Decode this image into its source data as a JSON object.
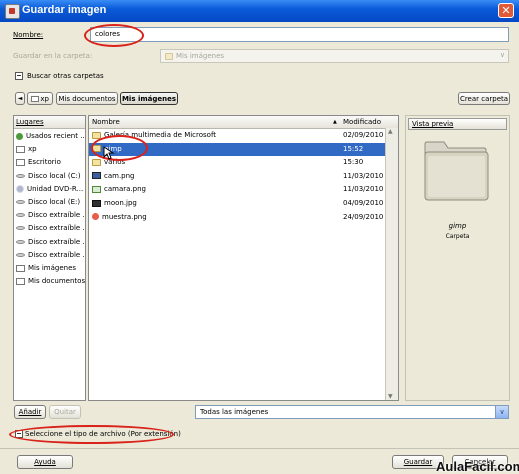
{
  "window": {
    "title": "Guardar imagen",
    "close_glyph": "✕"
  },
  "form": {
    "name_label": "Nombre:",
    "name_value": "colores",
    "folder_label": "Guardar en la carpeta:",
    "folder_value": "Mis imágenes",
    "browse_toggle": "Buscar otras carpetas"
  },
  "pathbar": {
    "back_glyph": "◄",
    "crumbs": [
      "xp",
      "Mis documentos",
      "Mis imágenes"
    ],
    "create_folder": "Crear carpeta"
  },
  "places": {
    "header": "Lugares",
    "items": [
      {
        "label": "Usados recient ...",
        "icon": "recent-icon"
      },
      {
        "label": "xp",
        "icon": "folder-icon"
      },
      {
        "label": "Escritorio",
        "icon": "desktop-folder-icon"
      },
      {
        "label": "Disco local (C:)",
        "icon": "drive-icon"
      },
      {
        "label": "Unidad DVD-R...",
        "icon": "dvd-icon"
      },
      {
        "label": "Disco local (E:)",
        "icon": "drive-icon"
      },
      {
        "label": "Disco extraíble ...",
        "icon": "drive-icon"
      },
      {
        "label": "Disco extraíble ...",
        "icon": "drive-icon"
      },
      {
        "label": "Disco extraíble ...",
        "icon": "drive-icon"
      },
      {
        "label": "Disco extraíble ...",
        "icon": "drive-icon"
      },
      {
        "label": "Mis imágenes",
        "icon": "folder-icon"
      },
      {
        "label": "Mis documentos",
        "icon": "folder-icon"
      }
    ],
    "add_button": "Añadir",
    "remove_button": "Quitar"
  },
  "files": {
    "col_name": "Nombre",
    "col_modified": "Modificado",
    "sort_glyph": "▲",
    "rows": [
      {
        "name": "Galería multimedia de Microsoft",
        "modified": "02/09/2010",
        "icon": "folder-icon"
      },
      {
        "name": "gimp",
        "modified": "15:52",
        "icon": "folder-icon"
      },
      {
        "name": "varios",
        "modified": "15:30",
        "icon": "folder-icon"
      },
      {
        "name": "cam.png",
        "modified": "11/03/2010",
        "icon": "image-file-icon"
      },
      {
        "name": "camara.png",
        "modified": "11/03/2010",
        "icon": "image-file-icon"
      },
      {
        "name": "moon.jpg",
        "modified": "04/09/2010",
        "icon": "image-file-icon"
      },
      {
        "name": "muestra.png",
        "modified": "24/09/2010",
        "icon": "image-file-icon"
      }
    ],
    "filter_value": "Todas las imágenes"
  },
  "preview": {
    "header": "Vista previa",
    "name": "gimp",
    "type": "Carpeta"
  },
  "filetype_toggle": "Seleccione el tipo de archivo (Por extensión)",
  "footer": {
    "help_button": "Ayuda",
    "save_button": "Guardar",
    "cancel_button": "Cancelar",
    "watermark": "AulaFacil.com"
  }
}
